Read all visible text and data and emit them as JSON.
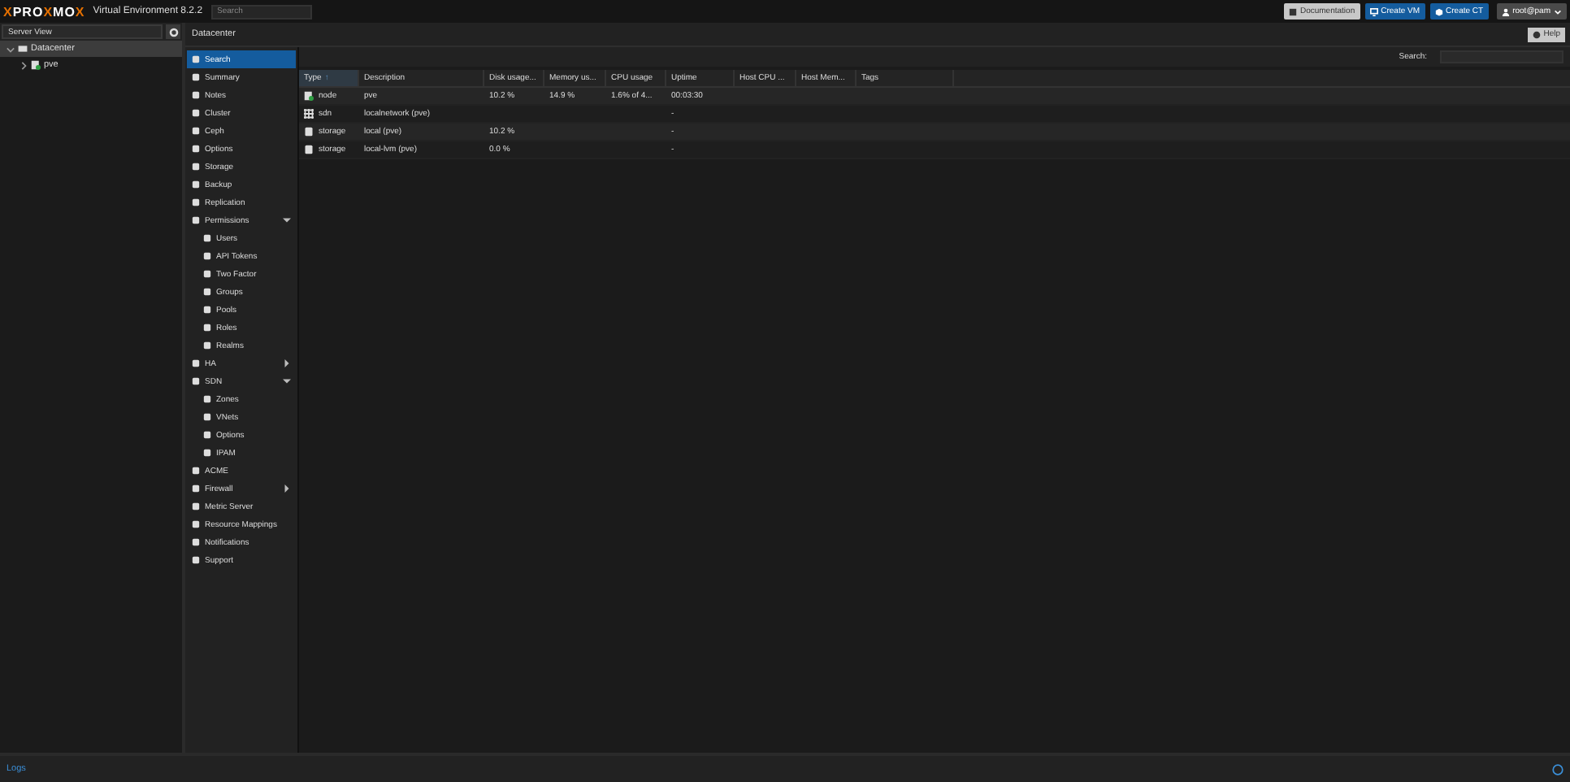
{
  "header": {
    "logo": [
      {
        "kind": "accent",
        "text": "X"
      },
      {
        "kind": "plain",
        "text": "PRO"
      },
      {
        "kind": "accent",
        "text": "X"
      },
      {
        "kind": "plain",
        "text": "MO"
      },
      {
        "kind": "accent",
        "text": "X"
      }
    ],
    "product": "Virtual Environment 8.2.2",
    "search": {
      "placeholder": "Search"
    },
    "buttons": [
      {
        "kind": "doc",
        "label": "Documentation"
      },
      {
        "kind": "vm",
        "label": "Create VM"
      },
      {
        "kind": "ct",
        "label": "Create CT"
      },
      {
        "kind": "user",
        "label": "root@pam"
      }
    ]
  },
  "server_view": {
    "label": "Server View"
  },
  "tree": [
    {
      "label": "Datacenter",
      "kind": "datacenter",
      "selected": true,
      "expanded": true,
      "children": [
        {
          "label": "pve",
          "kind": "node",
          "selected": false,
          "expanded": false
        }
      ]
    }
  ],
  "content": {
    "title": "Datacenter",
    "help": "Help",
    "search_label": "Search:"
  },
  "nav": [
    {
      "label": "Search",
      "selected": true
    },
    {
      "label": "Summary",
      "selected": false
    },
    {
      "label": "Notes",
      "selected": false
    },
    {
      "label": "Cluster",
      "selected": false
    },
    {
      "label": "Ceph",
      "selected": false
    },
    {
      "label": "Options",
      "selected": false
    },
    {
      "label": "Storage",
      "selected": false
    },
    {
      "label": "Backup",
      "selected": false
    },
    {
      "label": "Replication",
      "selected": false
    },
    {
      "label": "Permissions",
      "selected": false,
      "expanded": true,
      "children": [
        {
          "label": "Users",
          "selected": false
        },
        {
          "label": "API Tokens",
          "selected": false
        },
        {
          "label": "Two Factor",
          "selected": false
        },
        {
          "label": "Groups",
          "selected": false
        },
        {
          "label": "Pools",
          "selected": false
        },
        {
          "label": "Roles",
          "selected": false
        },
        {
          "label": "Realms",
          "selected": false
        }
      ]
    },
    {
      "label": "HA",
      "selected": false,
      "expanded": false
    },
    {
      "label": "SDN",
      "selected": false,
      "expanded": true,
      "children": [
        {
          "label": "Zones",
          "selected": false
        },
        {
          "label": "VNets",
          "selected": false
        },
        {
          "label": "Options",
          "selected": false
        },
        {
          "label": "IPAM",
          "selected": false
        }
      ]
    },
    {
      "label": "ACME",
      "selected": false
    },
    {
      "label": "Firewall",
      "selected": false,
      "expanded": false
    },
    {
      "label": "Metric Server",
      "selected": false
    },
    {
      "label": "Resource Mappings",
      "selected": false
    },
    {
      "label": "Notifications",
      "selected": false
    },
    {
      "label": "Support",
      "selected": false
    }
  ],
  "table": {
    "columns": [
      {
        "label": "Type",
        "sort": "↑"
      },
      {
        "label": "Description"
      },
      {
        "label": "Disk usage..."
      },
      {
        "label": "Memory us..."
      },
      {
        "label": "CPU usage"
      },
      {
        "label": "Uptime"
      },
      {
        "label": "Host CPU ..."
      },
      {
        "label": "Host Mem..."
      },
      {
        "label": "Tags"
      }
    ],
    "rows": [
      {
        "kind": "node",
        "cells": [
          "node",
          "pve",
          "10.2 %",
          "14.9 %",
          "1.6% of 4...",
          "00:03:30",
          "",
          "",
          ""
        ]
      },
      {
        "kind": "sdn",
        "cells": [
          "sdn",
          "localnetwork (pve)",
          "",
          "",
          "",
          "-",
          "",
          "",
          ""
        ]
      },
      {
        "kind": "storage",
        "cells": [
          "storage",
          "local (pve)",
          "10.2 %",
          "",
          "",
          "-",
          "",
          "",
          ""
        ]
      },
      {
        "kind": "storage",
        "cells": [
          "storage",
          "local-lvm (pve)",
          "0.0 %",
          "",
          "",
          "-",
          "",
          "",
          ""
        ]
      }
    ]
  },
  "log_panel": {
    "label": "Logs"
  }
}
